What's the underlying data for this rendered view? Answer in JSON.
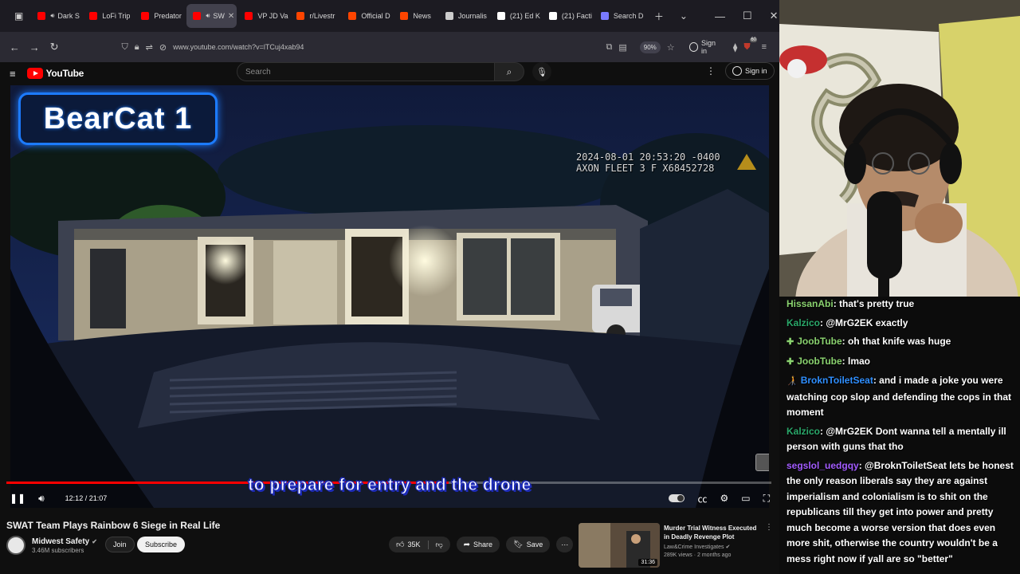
{
  "browser": {
    "tabs": [
      {
        "label": "Dark S",
        "favicon_color": "#ff0000",
        "active": false,
        "audio": true
      },
      {
        "label": "LoFi Trip",
        "favicon_color": "#ff0000",
        "active": false,
        "audio": false
      },
      {
        "label": "Predator",
        "favicon_color": "#ff0000",
        "active": false,
        "audio": false
      },
      {
        "label": "SW",
        "favicon_color": "#ff0000",
        "active": true,
        "audio": true
      },
      {
        "label": "VP JD Va",
        "favicon_color": "#ff0000",
        "active": false,
        "audio": false
      },
      {
        "label": "r/Livestr",
        "favicon_color": "#ff4500",
        "active": false,
        "audio": false
      },
      {
        "label": "Official D",
        "favicon_color": "#ff4500",
        "active": false,
        "audio": false
      },
      {
        "label": "News",
        "favicon_color": "#ff4500",
        "active": false,
        "audio": false
      },
      {
        "label": "Journalis",
        "favicon_color": "#cccccc",
        "active": false,
        "audio": false
      },
      {
        "label": "(21) Ed K",
        "favicon_color": "#ffffff",
        "active": false,
        "audio": false
      },
      {
        "label": "(21) Facti",
        "favicon_color": "#ffffff",
        "active": false,
        "audio": false
      },
      {
        "label": "Search D",
        "favicon_color": "#7a7aff",
        "active": false,
        "audio": false
      }
    ],
    "url": "www.youtube.com/watch?v=lTCuj4xab94",
    "zoom": "90%",
    "sign_in": "Sign in",
    "ext_badge": "60"
  },
  "youtube": {
    "logo": "YouTube",
    "search_placeholder": "Search",
    "sign_in": "Sign in"
  },
  "video": {
    "overlay_title": "BearCat 1",
    "timestamp_line1": "2024-08-01 20:53:20 -0400",
    "timestamp_line2": "AXON FLEET 3 F X68452728",
    "caption": "to prepare for entry and the drone",
    "current_time": "12:12",
    "duration": "21:07",
    "time_display": "12:12 / 21:07",
    "progress": 0.578
  },
  "details": {
    "title": "SWAT Team Plays Rainbow 6 Siege in Real Life",
    "channel": "Midwest Safety",
    "subscribers": "3.46M subscribers",
    "join": "Join",
    "subscribe": "Subscribe",
    "likes": "35K",
    "share": "Share",
    "save": "Save"
  },
  "recommendation": {
    "title": "Murder Trial Witness Executed in Deadly Revenge Plot",
    "channel": "Law&Crime Investigates",
    "meta": "289K views · 2 months ago",
    "duration": "31:36"
  },
  "chat": [
    {
      "user": "HissanAbi",
      "color": "#8ad26f",
      "badge": "",
      "text": ": that's pretty true"
    },
    {
      "user": "Kalzico",
      "color": "#2aa86a",
      "badge": "",
      "text": ": @MrG2EK exactly"
    },
    {
      "user": "JoobTube",
      "color": "#8ad26f",
      "badge": "✚",
      "text": ": oh that knife was huge"
    },
    {
      "user": "JoobTube",
      "color": "#8ad26f",
      "badge": "✚",
      "text": ": lmao"
    },
    {
      "user": "BroknToiletSeat",
      "color": "#2f8fff",
      "badge": "🧑‍🦯",
      "text": ": and i made a joke you were watching cop slop and defending the cops in that moment"
    },
    {
      "user": "Kalzico",
      "color": "#2aa86a",
      "badge": "",
      "text": ": @MrG2EK Dont wanna tell a mentally ill person with guns that tho"
    },
    {
      "user": "segslol_uedgqy",
      "color": "#a35cff",
      "badge": "",
      "text": ": @BroknToiletSeat lets be honest the only reason liberals say they are against imperialism and colonialism is to shit on the republicans till they get into power and pretty much become a worse version that does even more shit, otherwise the country wouldn't be a mess right now if yall are so \"better\""
    }
  ]
}
